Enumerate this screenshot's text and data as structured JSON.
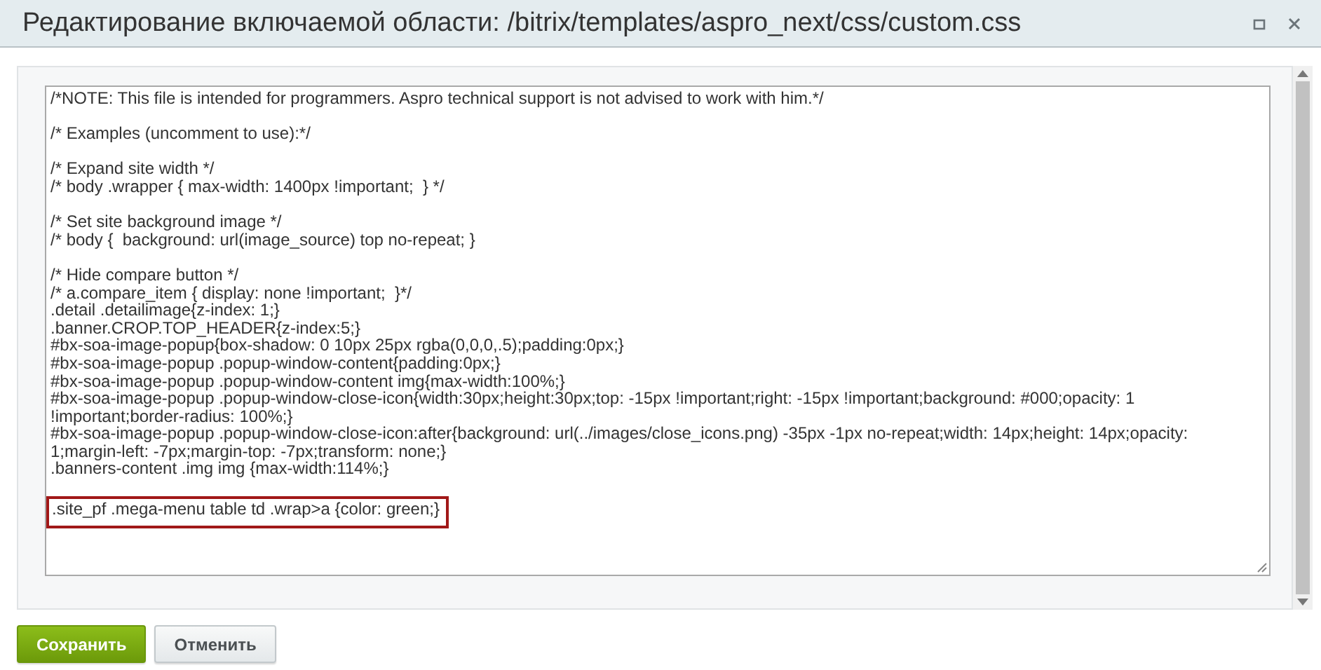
{
  "window": {
    "title": "Редактирование включаемой области: /bitrix/templates/aspro_next/css/custom.css"
  },
  "editor": {
    "blocks": [
      {
        "highlighted": false,
        "lines": [
          "/*NOTE: This file is intended for programmers. Aspro technical support is not advised to work with him.*/"
        ]
      },
      {
        "highlighted": false,
        "lines": [
          "/* Examples (uncomment to use):*/"
        ]
      },
      {
        "highlighted": false,
        "lines": [
          "/* Expand site width */",
          "/* body .wrapper { max-width: 1400px !important;  } */"
        ]
      },
      {
        "highlighted": false,
        "lines": [
          "/* Set site background image */",
          "/* body {  background: url(image_source) top no-repeat; }"
        ]
      },
      {
        "highlighted": false,
        "lines": [
          "/* Hide compare button */",
          "/* a.compare_item { display: none !important;  }*/",
          ".detail .detailimage{z-index: 1;}",
          ".banner.CROP.TOP_HEADER{z-index:5;}",
          "#bx-soa-image-popup{box-shadow: 0 10px 25px rgba(0,0,0,.5);padding:0px;}",
          "#bx-soa-image-popup .popup-window-content{padding:0px;}",
          "#bx-soa-image-popup .popup-window-content img{max-width:100%;}",
          "#bx-soa-image-popup .popup-window-close-icon{width:30px;height:30px;top: -15px !important;right: -15px !important;background: #000;opacity: 1 !important;border-radius: 100%;}",
          "#bx-soa-image-popup .popup-window-close-icon:after{background: url(../images/close_icons.png) -35px -1px no-repeat;width: 14px;height: 14px;opacity: 1;margin-left: -7px;margin-top: -7px;transform: none;}",
          ".banners-content .img img {max-width:114%;}"
        ]
      },
      {
        "highlighted": true,
        "lines": [
          ".site_pf .mega-menu table td .wrap>a {color: green;}"
        ]
      }
    ]
  },
  "buttons": [
    {
      "label": "Сохранить",
      "kind": "primary"
    },
    {
      "label": "Отменить",
      "kind": "secondary"
    }
  ]
}
